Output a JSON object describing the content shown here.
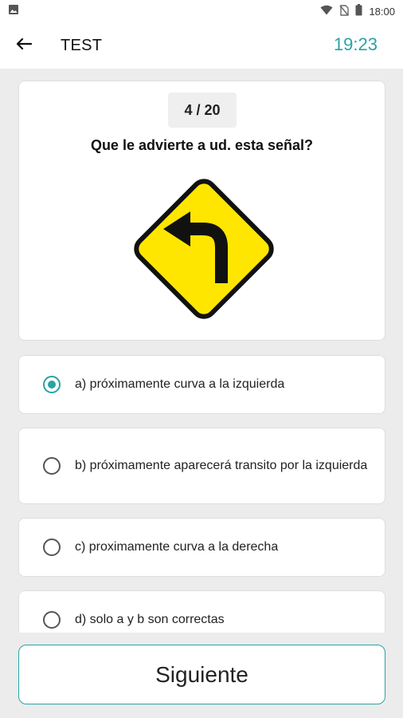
{
  "status_bar": {
    "time": "18:00",
    "icons": [
      "image-icon",
      "wifi-icon",
      "no-sim-icon",
      "battery-icon"
    ]
  },
  "app_bar": {
    "title": "TEST",
    "timer": "19:23",
    "back_icon": "arrow-left-icon",
    "accent_color": "#2aa3a4"
  },
  "question": {
    "counter": "4 / 20",
    "text": "Que le advierte a ud. esta señal?",
    "sign": {
      "type": "curve-left-warning-sign",
      "fill_color": "#ffe600",
      "border_color": "#111111"
    }
  },
  "options": [
    {
      "label": "a) próximamente curva a la izquierda",
      "selected": true
    },
    {
      "label": "b) próximamente aparecerá transito por la izquierda",
      "selected": false
    },
    {
      "label": "c) proximamente curva a la derecha",
      "selected": false
    },
    {
      "label": "d) solo a y b son correctas",
      "selected": false
    }
  ],
  "footer": {
    "next_label": "Siguiente"
  }
}
